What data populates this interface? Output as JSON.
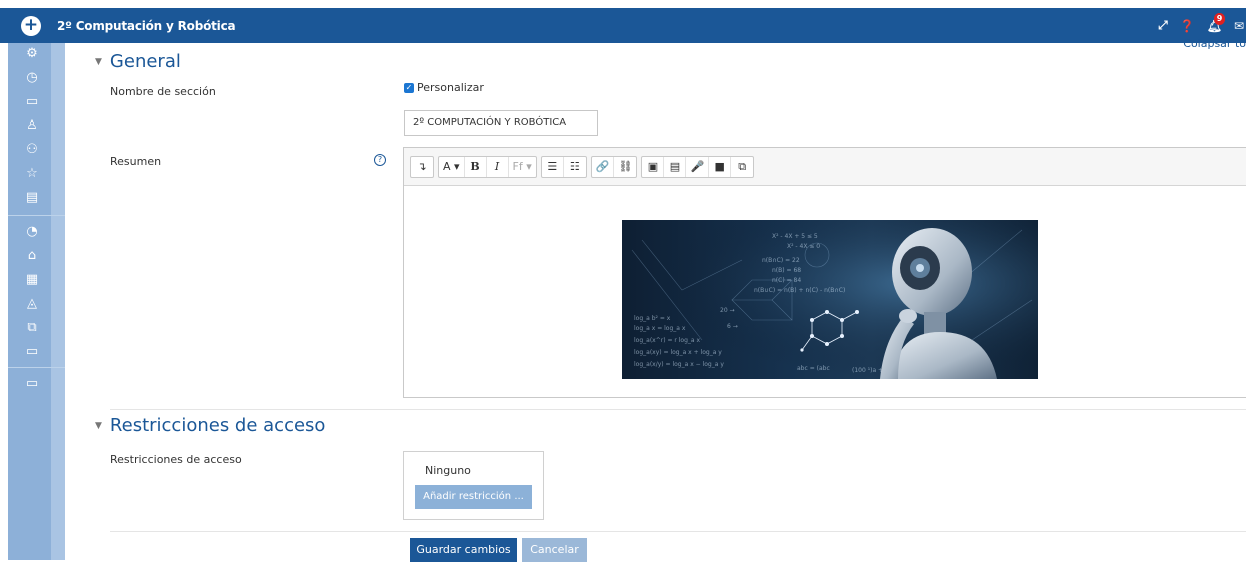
{
  "topbar": {
    "course_title": "2º Computación y Robótica",
    "notification_count": "9",
    "icons": [
      "expand-icon",
      "help-icon",
      "bell-icon",
      "mail-icon"
    ]
  },
  "sidebar": {
    "icons": [
      "cogs-icon",
      "clock-icon",
      "folder-icon",
      "users-icon",
      "user-group-icon",
      "star-icon",
      "book-icon",
      "dashboard-icon",
      "home-icon",
      "calendar-icon",
      "graduation-cap-icon",
      "files-icon",
      "folder-icon",
      "folder-icon"
    ]
  },
  "collapse_link": "Colapsar to",
  "general": {
    "heading": "General",
    "section_name_label": "Nombre de sección",
    "customize_label": "Personalizar",
    "section_name_value": "2º COMPUTACIÓN Y ROBÓTICA",
    "summary_label": "Resumen"
  },
  "editor": {
    "toolbar": [
      [
        "↴"
      ],
      [
        "A ▾",
        "B",
        "I",
        "Ff ▾"
      ],
      [
        "☰",
        "☷"
      ],
      [
        "🔗",
        "⛓"
      ],
      [
        "▣",
        "▤",
        "🎤",
        "■",
        "⧉"
      ]
    ],
    "image_alt": "robot-with-math-formulas-image"
  },
  "access": {
    "heading": "Restricciones de acceso",
    "label": "Restricciones de acceso",
    "none_text": "Ninguno",
    "add_button": "Añadir restricción ..."
  },
  "actions": {
    "save": "Guardar cambios",
    "cancel": "Cancelar"
  },
  "colors": {
    "brand": "#1b5797",
    "sidebar": "#8db0d8",
    "badge": "#e02020"
  }
}
